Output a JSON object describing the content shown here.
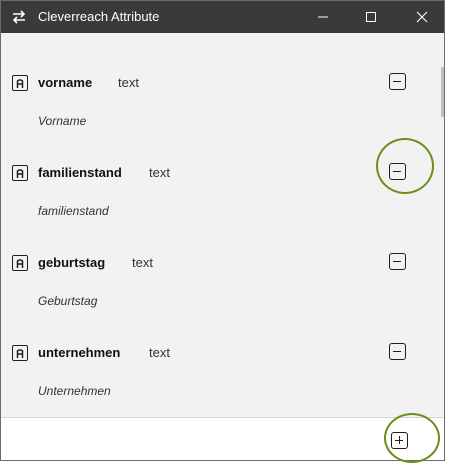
{
  "window": {
    "title": "Cleverreach Attribute",
    "app_icon": "swap-arrows-icon",
    "controls": [
      "minimize-icon",
      "maximize-icon",
      "close-icon"
    ]
  },
  "attributes": [
    {
      "name": "vorname",
      "type": "text",
      "label": "Vorname"
    },
    {
      "name": "familienstand",
      "type": "text",
      "label": "familienstand"
    },
    {
      "name": "geburtstag",
      "type": "text",
      "label": "Geburtstag"
    },
    {
      "name": "unternehmen",
      "type": "text",
      "label": "Unternehmen"
    }
  ],
  "icons": {
    "attribute": "attribute-icon",
    "remove": "remove-icon",
    "add": "add-icon"
  },
  "colors": {
    "titlebar": "#3a3a3a",
    "list_background": "#f2f2f2",
    "highlight": "#6a8f1a"
  }
}
